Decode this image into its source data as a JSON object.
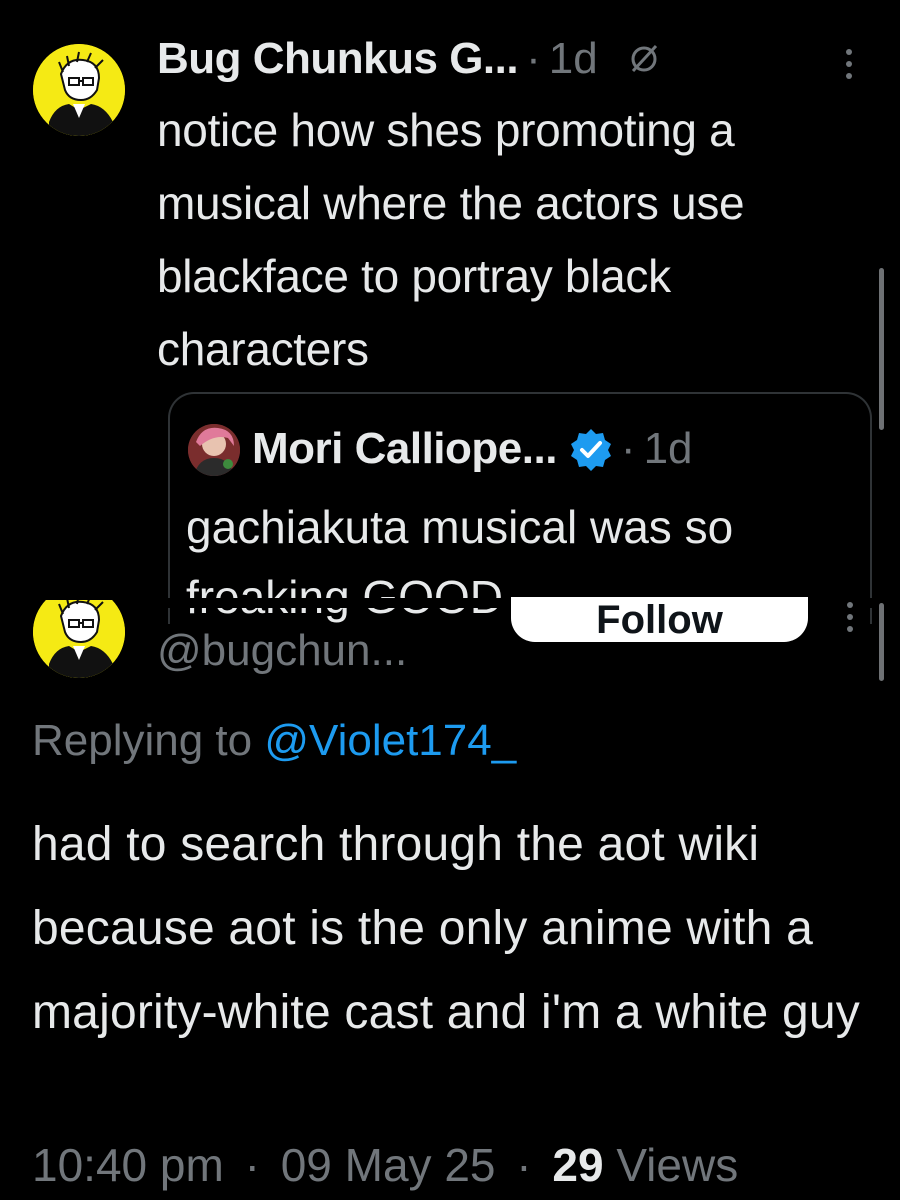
{
  "colors": {
    "background": "#000000",
    "text": "#e7e9ea",
    "secondary": "#71767b",
    "link": "#1d9bf0",
    "avatar_bg": "#f5ea14",
    "verified": "#1d9bf0"
  },
  "tweet1": {
    "name": "Bug Chunkus G...",
    "separator": "·",
    "time": "1d",
    "icons": [
      "mute-icon",
      "more-vertical-icon"
    ],
    "text": "notice how shes promoting a musical where the actors use blackface to portray black characters",
    "quote": {
      "name": "Mori Calliope...",
      "separator": "·",
      "time": "1d",
      "verified_icon": "verified-badge-icon",
      "text": "gachiakuta musical was so freaking GOOD"
    }
  },
  "tweet2": {
    "follow_label": "Follow",
    "handle": "@bugchun...",
    "replying_prefix": "Replying to ",
    "replying_mention": "@Violet174_",
    "text": "had to search through the aot wiki because aot is the only anime with a majority-white cast and i'm a white guy",
    "time": "10:40 pm",
    "separator": "·",
    "date": "09 May 25",
    "views_count": "29",
    "views_label": "Views"
  }
}
